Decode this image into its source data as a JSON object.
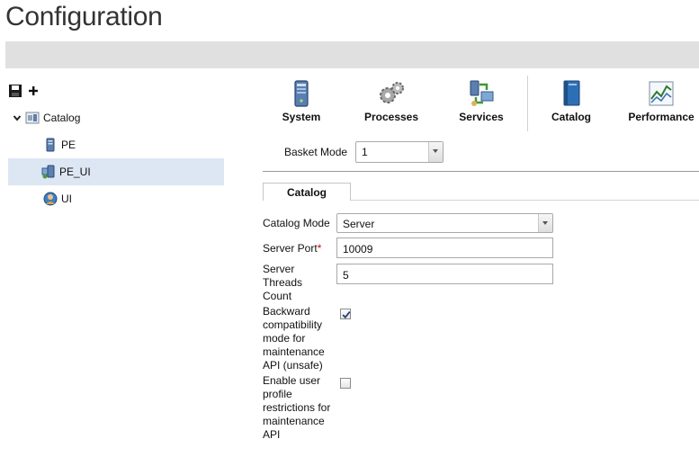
{
  "page": {
    "title": "Configuration"
  },
  "tree": {
    "toolbar": {
      "save_icon": "floppy-disk-icon",
      "add_icon": "plus-icon"
    },
    "root": {
      "label": "Catalog",
      "icon": "catalog-server-icon"
    },
    "children": [
      {
        "label": "PE",
        "icon": "server-icon"
      },
      {
        "label": "PE_UI",
        "icon": "server-ui-icon",
        "selected": true
      },
      {
        "label": "UI",
        "icon": "user-globe-icon"
      }
    ]
  },
  "toolbar": {
    "items": [
      {
        "label": "System",
        "icon": "server-tower-icon"
      },
      {
        "label": "Processes",
        "icon": "gears-icon"
      },
      {
        "label": "Services",
        "icon": "network-services-icon"
      },
      {
        "label": "Catalog",
        "icon": "book-icon"
      },
      {
        "label": "Performance",
        "icon": "chart-icon"
      }
    ]
  },
  "basket": {
    "label": "Basket Mode",
    "value": "1"
  },
  "tab": {
    "label": "Catalog"
  },
  "form": {
    "catalog_mode": {
      "label": "Catalog Mode",
      "value": "Server"
    },
    "server_port": {
      "label": "Server Port",
      "required_mark": "*",
      "value": "10009"
    },
    "server_threads": {
      "label_lines": [
        "Server",
        "Threads",
        "Count"
      ],
      "value": "5"
    },
    "backward_compat": {
      "label_lines": [
        "Backward",
        "compatibility",
        "mode for",
        "maintenance",
        "API (unsafe)"
      ],
      "checked": true
    },
    "user_profile": {
      "label_lines": [
        "Enable user",
        "profile",
        "restrictions for",
        "maintenance",
        "API"
      ],
      "checked": false
    }
  }
}
